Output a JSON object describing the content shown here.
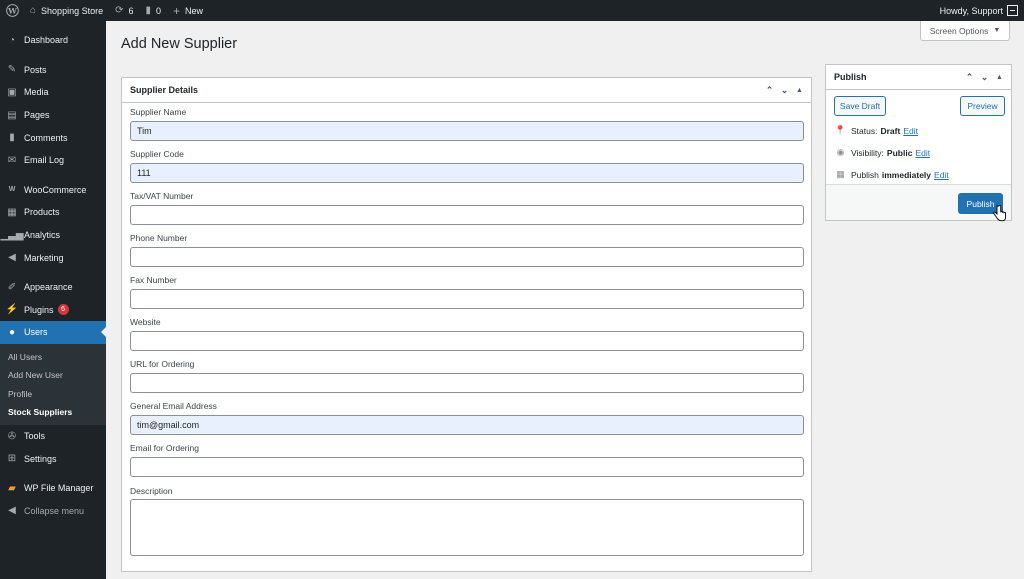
{
  "adminbar": {
    "site_name": "Shopping Store",
    "updates_count": "6",
    "comments_count": "0",
    "new_label": "New",
    "howdy": "Howdy, Support"
  },
  "sidebar": {
    "items": [
      {
        "label": "Dashboard",
        "icon": "dashboard-icon"
      },
      {
        "label": "Posts",
        "icon": "pin-icon"
      },
      {
        "label": "Media",
        "icon": "media-icon"
      },
      {
        "label": "Pages",
        "icon": "pages-icon"
      },
      {
        "label": "Comments",
        "icon": "comment-icon"
      },
      {
        "label": "Email Log",
        "icon": "email-icon"
      },
      {
        "label": "WooCommerce",
        "icon": "woo-icon"
      },
      {
        "label": "Products",
        "icon": "products-icon"
      },
      {
        "label": "Analytics",
        "icon": "analytics-icon"
      },
      {
        "label": "Marketing",
        "icon": "megaphone-icon"
      },
      {
        "label": "Appearance",
        "icon": "brush-icon"
      },
      {
        "label": "Plugins",
        "icon": "plugin-icon",
        "badge": "6"
      },
      {
        "label": "Users",
        "icon": "users-icon"
      },
      {
        "label": "Tools",
        "icon": "wrench-icon"
      },
      {
        "label": "Settings",
        "icon": "settings-icon"
      },
      {
        "label": "WP File Manager",
        "icon": "folder-icon"
      },
      {
        "label": "Collapse menu",
        "icon": "collapse-icon"
      }
    ],
    "submenu": [
      "All Users",
      "Add New User",
      "Profile",
      "Stock Suppliers"
    ]
  },
  "page": {
    "title": "Add New Supplier",
    "screen_options": "Screen Options"
  },
  "supplier_box": {
    "title": "Supplier Details",
    "fields": [
      {
        "label": "Supplier Name",
        "value": "Tim"
      },
      {
        "label": "Supplier Code",
        "value": "111"
      },
      {
        "label": "Tax/VAT Number",
        "value": ""
      },
      {
        "label": "Phone Number",
        "value": ""
      },
      {
        "label": "Fax Number",
        "value": ""
      },
      {
        "label": "Website",
        "value": ""
      },
      {
        "label": "URL for Ordering",
        "value": ""
      },
      {
        "label": "General Email Address",
        "value": "tim@gmail.com"
      },
      {
        "label": "Email for Ordering",
        "value": ""
      }
    ],
    "description_label": "Description"
  },
  "publish_box": {
    "title": "Publish",
    "save_draft": "Save Draft",
    "preview": "Preview",
    "status_label": "Status:",
    "status_value": "Draft",
    "visibility_label": "Visibility:",
    "visibility_value": "Public",
    "publish_label": "Publish",
    "publish_value": "immediately",
    "edit": "Edit",
    "publish_button": "Publish"
  },
  "colors": {
    "admin_dark": "#1d2327",
    "accent": "#2271b1",
    "badge": "#d63638",
    "autofill": "#e8f0fe"
  }
}
